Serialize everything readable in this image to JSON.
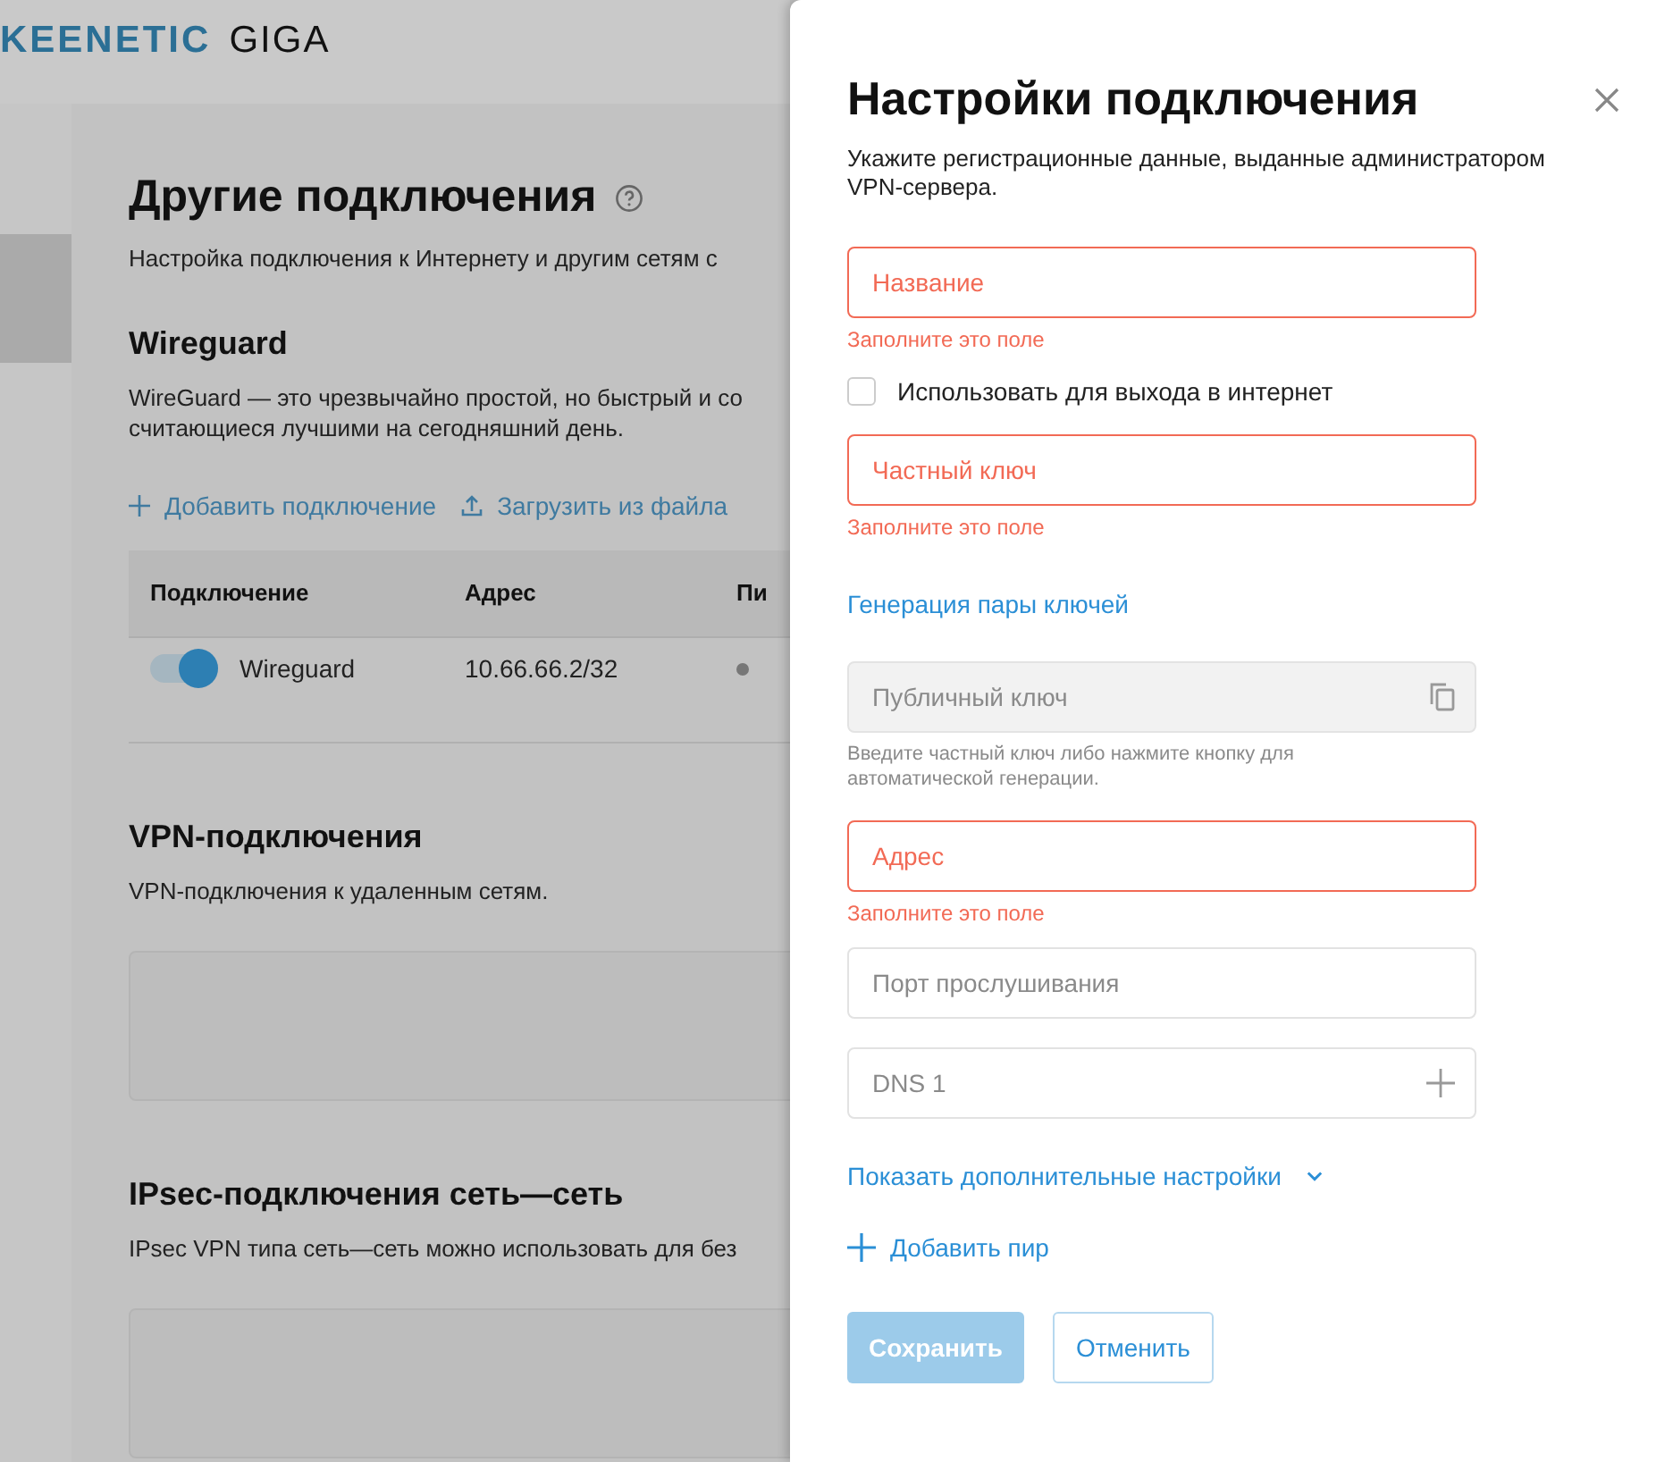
{
  "header": {
    "brand": "KEENETIC",
    "model": "GIGA"
  },
  "page": {
    "title": "Другие подключения",
    "description": "Настройка подключения к Интернету и другим сетям с",
    "sections": [
      {
        "kind": "table",
        "title": "Wireguard",
        "description": [
          "WireGuard — это чрезвычайно простой, но быстрый и со",
          "считающиеся лучшими на сегодняшний день."
        ],
        "actions": [
          {
            "label": "Добавить подключение"
          },
          {
            "label": "Загрузить из файла"
          }
        ],
        "table": {
          "columns": [
            "Подключение",
            "Адрес",
            "Пи"
          ],
          "rows": [
            {
              "enabled": true,
              "name": "Wireguard",
              "address": "10.66.66.2/32"
            }
          ]
        }
      },
      {
        "kind": "card",
        "title": "VPN-подключения",
        "description": [
          "VPN-подключения к удаленным сетям."
        ]
      },
      {
        "kind": "card",
        "title": "IPsec-подключения сеть—сеть",
        "description": [
          "IPsec VPN типа сеть—сеть можно использовать для без"
        ]
      }
    ]
  },
  "drawer": {
    "title": "Настройки подключения",
    "subtitle": "Укажите регистрационные данные, выданные администратором VPN-сервера.",
    "items": [
      {
        "kind": "field",
        "placeholder": "Название",
        "invalid": true,
        "error": "Заполните это поле"
      },
      {
        "kind": "checkbox",
        "label": "Использовать для выхода в интернет",
        "checked": false
      },
      {
        "kind": "field",
        "placeholder": "Частный ключ",
        "invalid": true,
        "error": "Заполните это поле"
      },
      {
        "kind": "link",
        "label": "Генерация пары ключей"
      },
      {
        "kind": "copyfield",
        "placeholder": "Публичный ключ",
        "invalid": false,
        "disabled": true,
        "hint": "Введите частный ключ либо нажмите кнопку для автоматической генерации."
      },
      {
        "kind": "field",
        "placeholder": "Адрес",
        "invalid": true,
        "error": "Заполните это поле"
      },
      {
        "kind": "field",
        "placeholder": "Порт прослушивания",
        "invalid": false
      },
      {
        "kind": "listfield",
        "placeholder": "DNS 1",
        "invalid": false
      },
      {
        "kind": "expander",
        "label": "Показать дополнительные настройки",
        "expanded": false
      },
      {
        "kind": "add",
        "label": "Добавить пир"
      }
    ],
    "buttons": [
      {
        "kind": "primary",
        "label": "Сохранить",
        "disabled": true
      },
      {
        "kind": "secondary",
        "label": "Отменить",
        "disabled": false
      }
    ]
  }
}
